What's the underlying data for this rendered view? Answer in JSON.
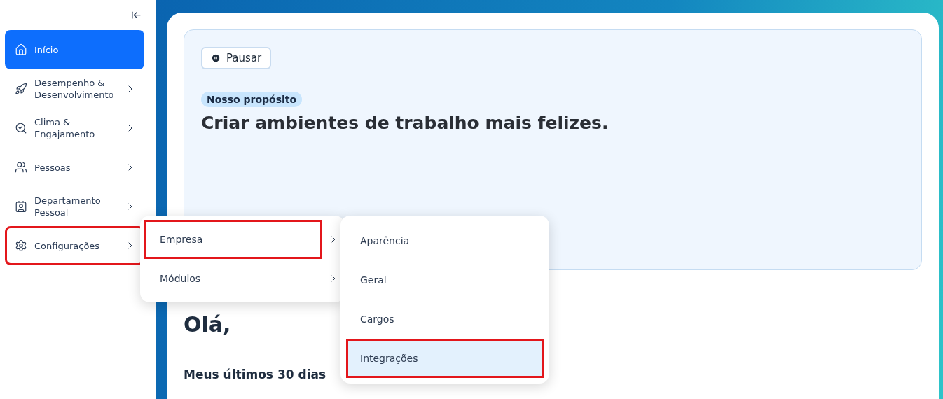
{
  "sidebar": {
    "items": [
      {
        "label": "Início",
        "selected": true,
        "has_submenu": false,
        "highlighted": false
      },
      {
        "label": "Desempenho & Desenvolvimento",
        "selected": false,
        "has_submenu": true,
        "highlighted": false
      },
      {
        "label": "Clima & Engajamento",
        "selected": false,
        "has_submenu": true,
        "highlighted": false
      },
      {
        "label": "Pessoas",
        "selected": false,
        "has_submenu": true,
        "highlighted": false
      },
      {
        "label": "Departamento Pessoal",
        "selected": false,
        "has_submenu": true,
        "highlighted": false
      },
      {
        "label": "Configurações",
        "selected": false,
        "has_submenu": true,
        "highlighted": true
      }
    ]
  },
  "submenu": {
    "items": [
      {
        "label": "Empresa",
        "highlighted": true
      },
      {
        "label": "Módulos",
        "highlighted": false
      }
    ]
  },
  "subsubmenu": {
    "items": [
      {
        "label": "Aparência",
        "selected": false,
        "highlighted": false
      },
      {
        "label": "Geral",
        "selected": false,
        "highlighted": false
      },
      {
        "label": "Cargos",
        "selected": false,
        "highlighted": false
      },
      {
        "label": "Integrações",
        "selected": true,
        "highlighted": true
      }
    ]
  },
  "main": {
    "pause_button": "Pausar",
    "badge": "Nosso propósito",
    "headline": "Criar ambientes de trabalho mais felizes.",
    "greeting": "Olá,",
    "section_title": "Meus últimos 30 dias"
  }
}
